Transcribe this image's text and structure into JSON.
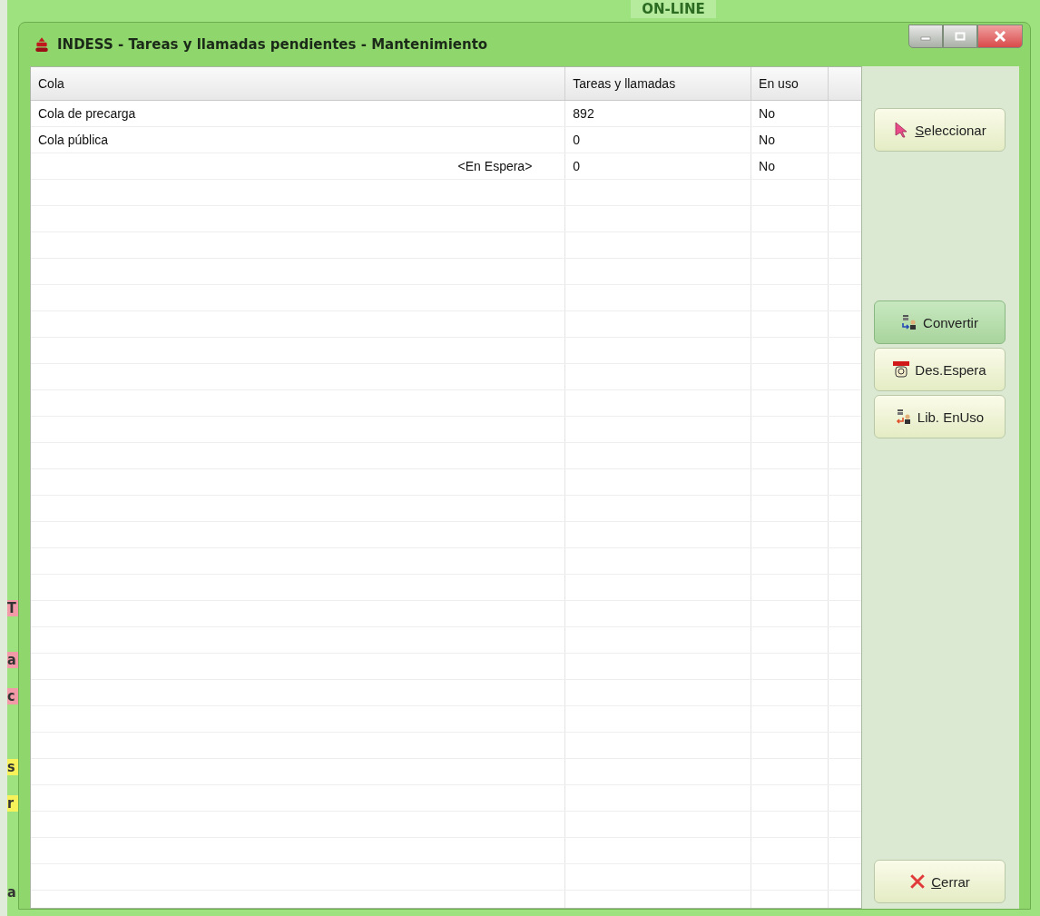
{
  "background_app": {
    "header_text": "ON-LINE",
    "edge_texts": [
      {
        "text": "T",
        "color": "#f29aa8"
      },
      {
        "text": "a",
        "color": "#f29aa8"
      },
      {
        "text": "c",
        "color": "#f29aa8"
      },
      {
        "text": "s",
        "color": "#f7f25a"
      },
      {
        "text": "r",
        "color": "#f7f25a"
      },
      {
        "text": "a",
        "color": "#9ee27f"
      }
    ]
  },
  "window": {
    "title": "INDESS - Tareas y llamadas pendientes - Mantenimiento"
  },
  "table": {
    "columns": [
      "Cola",
      "Tareas y llamadas",
      "En uso"
    ],
    "rows": [
      {
        "kind": "queue",
        "cola": "Cola de precarga",
        "tareas": "892",
        "en_uso": "No"
      },
      {
        "kind": "queue",
        "cola": "Cola pública",
        "tareas": "0",
        "en_uso": "No"
      },
      {
        "kind": "waiting",
        "cola": "<En Espera>",
        "tareas": "0",
        "en_uso": "No"
      }
    ]
  },
  "buttons": [
    {
      "kind": "select",
      "accel": "S",
      "rest": "eleccionar",
      "selected": false
    },
    {
      "kind": "convert",
      "rest": "Convertir",
      "selected": true
    },
    {
      "kind": "unwait",
      "rest": "Des.Espera",
      "selected": false
    },
    {
      "kind": "release",
      "rest": "Lib. EnUso",
      "selected": false
    },
    {
      "kind": "close",
      "accel": "C",
      "rest": "errar",
      "selected": false
    }
  ]
}
